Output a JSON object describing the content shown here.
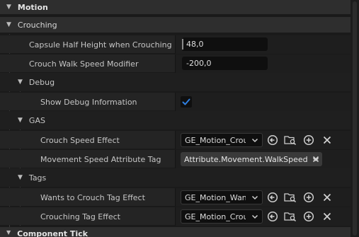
{
  "categories": {
    "motion": "Motion",
    "component_tick": "Component Tick"
  },
  "crouching": {
    "header": "Crouching",
    "capsule_half_height": {
      "label": "Capsule Half Height when Crouching",
      "value": "48,0"
    },
    "crouch_walk_speed_modifier": {
      "label": "Crouch Walk Speed Modifier",
      "value": "-200,0"
    },
    "debug": {
      "header": "Debug",
      "show_debug_information": {
        "label": "Show Debug Information",
        "checked": true
      }
    },
    "gas": {
      "header": "GAS",
      "crouch_speed_effect": {
        "label": "Crouch Speed Effect",
        "value": "GE_Motion_Crou"
      },
      "movement_speed_attribute_tag": {
        "label": "Movement Speed Attribute Tag",
        "value": "Attribute.Movement.WalkSpeed"
      }
    },
    "tags": {
      "header": "Tags",
      "wants_to_crouch_tag_effect": {
        "label": "Wants to Crouch Tag Effect",
        "value": "GE_Motion_Want"
      },
      "crouching_tag_effect": {
        "label": "Crouching Tag Effect",
        "value": "GE_Motion_Crou"
      }
    }
  },
  "icons": {
    "collapse": "chevron-down-icon",
    "use_selected": "use-selected-arrow-icon",
    "browse": "folder-search-icon",
    "add": "plus-circle-icon",
    "clear": "close-icon",
    "check": "checkmark-icon"
  },
  "colors": {
    "checkbox_accent": "#2f7fe0",
    "category_header": "#2e2e2e",
    "value_field": "#0f0f0f"
  }
}
